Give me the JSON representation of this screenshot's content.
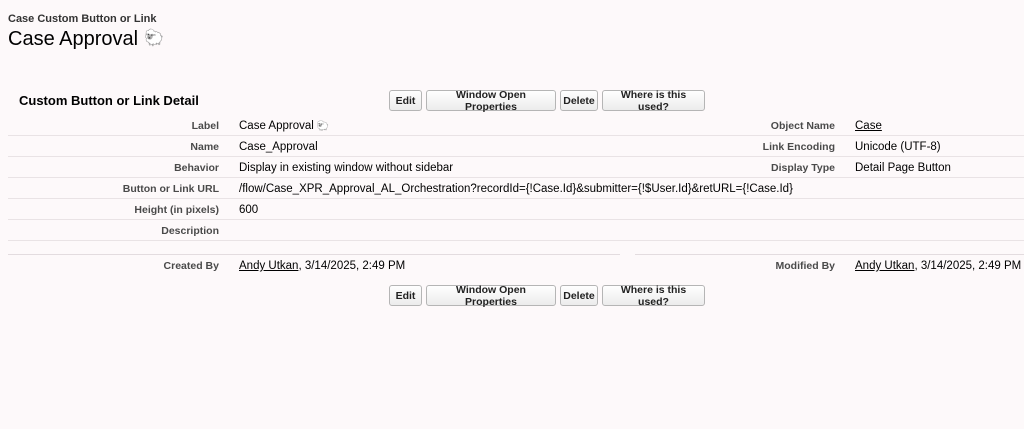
{
  "header": {
    "type_label": "Case Custom Button or Link",
    "title": "Case Approval",
    "title_emoji": "🐑"
  },
  "section": {
    "title": "Custom Button or Link Detail"
  },
  "buttons": {
    "edit": "Edit",
    "window_open_properties": "Window Open Properties",
    "delete": "Delete",
    "where_used": "Where is this used?"
  },
  "details": {
    "label": {
      "label": "Label",
      "value": "Case Approval",
      "emoji": "🐑"
    },
    "object_name": {
      "label": "Object Name",
      "value": "Case"
    },
    "name": {
      "label": "Name",
      "value": "Case_Approval"
    },
    "link_encoding": {
      "label": "Link Encoding",
      "value": "Unicode (UTF-8)"
    },
    "behavior": {
      "label": "Behavior",
      "value": "Display in existing window without sidebar"
    },
    "display_type": {
      "label": "Display Type",
      "value": "Detail Page Button"
    },
    "url": {
      "label": "Button or Link URL",
      "value": "/flow/Case_XPR_Approval_AL_Orchestration?recordId={!Case.Id}&submitter={!$User.Id}&retURL={!Case.Id}"
    },
    "height": {
      "label": "Height (in pixels)",
      "value": "600"
    },
    "description": {
      "label": "Description",
      "value": ""
    }
  },
  "info": {
    "created_by": {
      "label": "Created By",
      "user": "Andy Utkan",
      "date": ", 3/14/2025, 2:49 PM"
    },
    "modified_by": {
      "label": "Modified By",
      "user": "Andy Utkan",
      "date": ", 3/14/2025, 2:49 PM"
    }
  }
}
